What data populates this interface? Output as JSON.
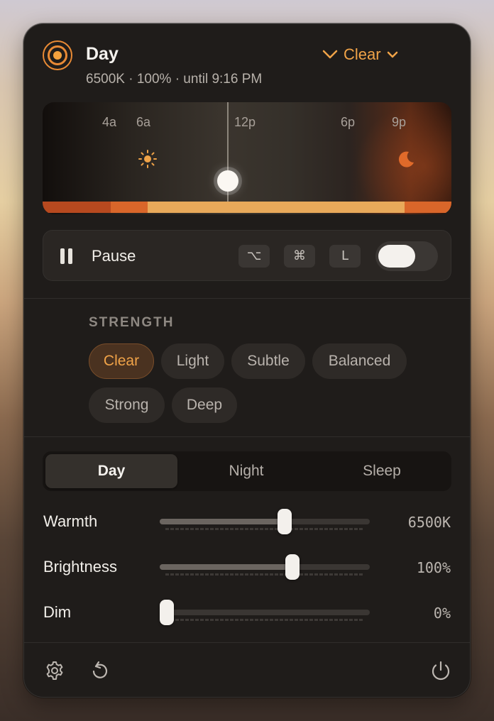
{
  "header": {
    "title": "Day",
    "subtitle": "6500K · 100% · until 9:16 PM",
    "preset_label": "Clear",
    "accent_color": "#f0a348"
  },
  "timeline": {
    "ticks": [
      "4a",
      "6a",
      "12p",
      "6p",
      "9p"
    ],
    "sun_icon": "sun-icon",
    "moon_icon": "moon-icon"
  },
  "pause_row": {
    "label": "Pause",
    "shortcut_keys": [
      "⌥",
      "⌘",
      "L"
    ],
    "toggle_on": false
  },
  "strength": {
    "label": "STRENGTH",
    "options": [
      "Clear",
      "Light",
      "Subtle",
      "Balanced",
      "Strong",
      "Deep"
    ],
    "selected": "Clear"
  },
  "modes": {
    "tabs": [
      "Day",
      "Night",
      "Sleep"
    ],
    "selected": "Day"
  },
  "sliders": [
    {
      "label": "Warmth",
      "value": "6500K",
      "level": 0.6
    },
    {
      "label": "Brightness",
      "value": "100%",
      "level": 0.64
    },
    {
      "label": "Dim",
      "value": "0%",
      "level": 0.0
    }
  ],
  "footer": {
    "icons": [
      "settings-icon",
      "reset-icon",
      "power-icon"
    ]
  }
}
